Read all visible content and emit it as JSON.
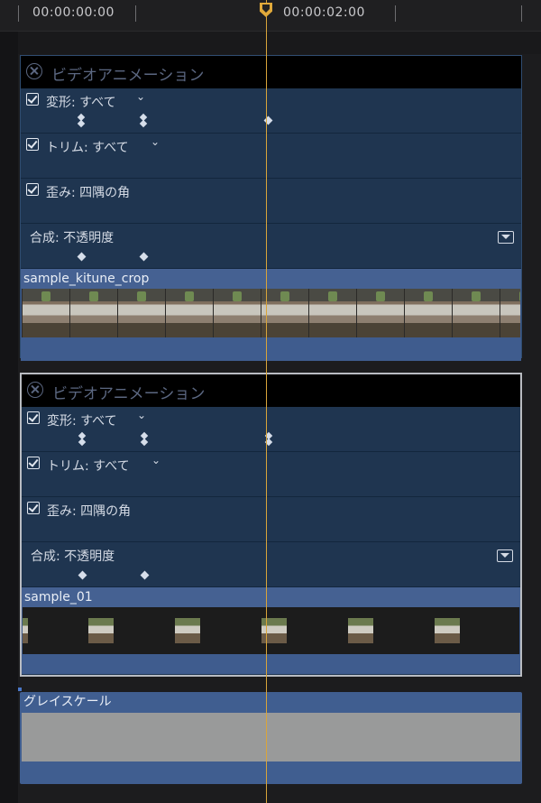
{
  "ruler": {
    "times": [
      "00:00:00:00",
      "00:00:02:00"
    ]
  },
  "clips": [
    {
      "title": "ビデオアニメーション",
      "rows": [
        {
          "label": "変形: すべて",
          "checked": true,
          "chevron": "chevron-down-icon"
        },
        {
          "label": "トリム: すべて",
          "checked": true,
          "chevron": "chevron-down-icon"
        },
        {
          "label": "歪み: 四隅の角",
          "checked": true
        },
        {
          "label": "合成: 不透明度",
          "checked": false,
          "dropdown": "dropdown-icon"
        }
      ],
      "media_name": "sample_kitune_crop"
    },
    {
      "title": "ビデオアニメーション",
      "rows": [
        {
          "label": "変形: すべて",
          "checked": true,
          "chevron": "chevron-down-icon"
        },
        {
          "label": "トリム: すべて",
          "checked": true,
          "chevron": "chevron-down-icon"
        },
        {
          "label": "歪み: 四隅の角",
          "checked": true
        },
        {
          "label": "合成: 不透明度",
          "checked": false,
          "dropdown": "dropdown-icon"
        }
      ],
      "media_name": "sample_01"
    }
  ],
  "effect_clip": {
    "name": "グレイスケール"
  },
  "colors": {
    "playhead": "#d9a53a",
    "clip_bg": "#1f3550",
    "media_bg": "#3e5a8a"
  }
}
